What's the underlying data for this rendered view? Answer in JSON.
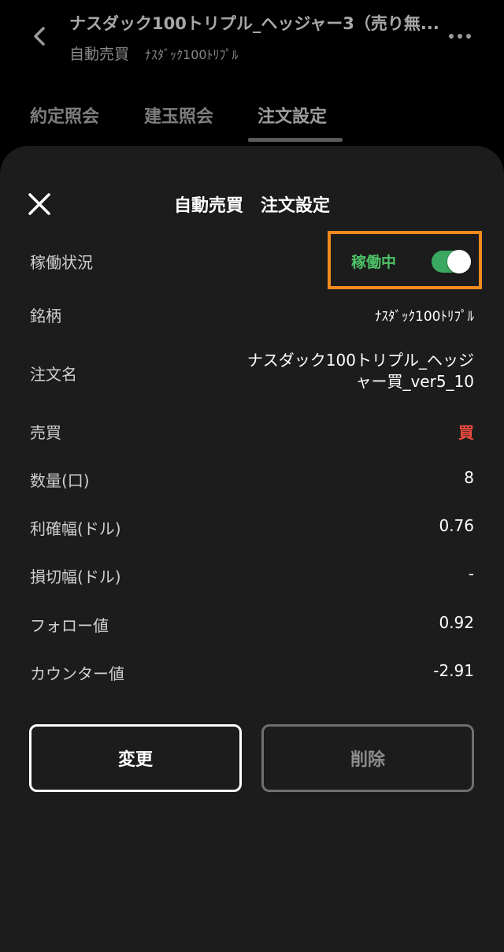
{
  "header": {
    "title": "ナスダック100トリプル_ヘッジャー3（売り無...",
    "subtitle_a": "自動売買",
    "subtitle_b": "ﾅｽﾀﾞｯｸ100ﾄﾘﾌﾟﾙ",
    "back_icon": "chevron-left-icon",
    "more_icon": "more-horizontal-icon"
  },
  "tabs": [
    {
      "label": "約定照会"
    },
    {
      "label": "建玉照会"
    },
    {
      "label": "注文設定",
      "active": true
    }
  ],
  "sheet": {
    "title": "自動売買　注文設定",
    "close_icon": "close-icon"
  },
  "status": {
    "label": "稼働状況",
    "value": "稼働中",
    "toggle_on": true,
    "highlight_color": "#f28a1e",
    "active_color": "#4ec367"
  },
  "rows": [
    {
      "label": "銘柄",
      "value": "ﾅｽﾀﾞｯｸ100ﾄﾘﾌﾟﾙ"
    },
    {
      "label": "注文名",
      "value": "ナスダック100トリプル_ヘッジャー買_ver5_10"
    },
    {
      "label": "売買",
      "value": "買"
    },
    {
      "label": "数量(口)",
      "value": "8"
    },
    {
      "label": "利確幅(ドル)",
      "value": "0.76"
    },
    {
      "label": "損切幅(ドル)",
      "value": "-"
    },
    {
      "label": "フォロー値",
      "value": "0.92"
    },
    {
      "label": "カウンター値",
      "value": "-2.91"
    }
  ],
  "buttons": {
    "change": "変更",
    "delete": "削除"
  },
  "colors": {
    "buy": "#ee4b3e",
    "sheet_bg": "#1c1c1c"
  }
}
